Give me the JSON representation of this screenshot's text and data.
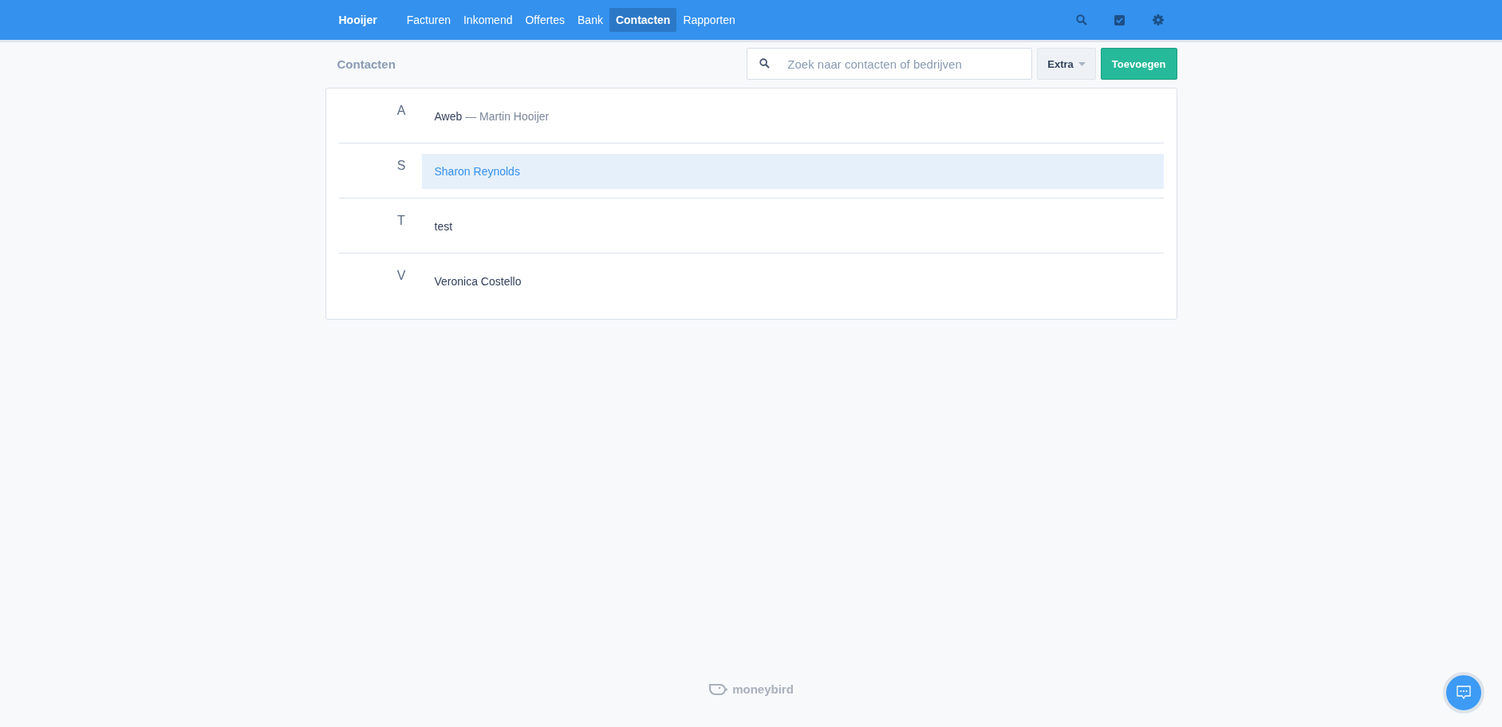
{
  "nav": {
    "brand": "Hooijer",
    "items": [
      {
        "label": "Facturen",
        "selected": false
      },
      {
        "label": "Inkomend",
        "selected": false
      },
      {
        "label": "Offertes",
        "selected": false
      },
      {
        "label": "Bank",
        "selected": false
      },
      {
        "label": "Contacten",
        "selected": true
      },
      {
        "label": "Rapporten",
        "selected": false
      }
    ]
  },
  "toolbar": {
    "title": "Contacten",
    "search": {
      "placeholder": "Zoek naar contacten of bedrijven"
    },
    "extra_button": "Extra",
    "add_button": "Toevoegen"
  },
  "groups": [
    {
      "letter": "A",
      "contacts": [
        {
          "name": "Aweb",
          "separator": "—",
          "person": "Martin Hooijer",
          "selected": false
        }
      ]
    },
    {
      "letter": "S",
      "contacts": [
        {
          "name": "Sharon Reynolds",
          "selected": true
        }
      ]
    },
    {
      "letter": "T",
      "contacts": [
        {
          "name": "test",
          "selected": false
        }
      ]
    },
    {
      "letter": "V",
      "contacts": [
        {
          "name": "Veronica Costello",
          "selected": false
        }
      ]
    }
  ],
  "footer": {
    "logo_text": "moneybird"
  }
}
